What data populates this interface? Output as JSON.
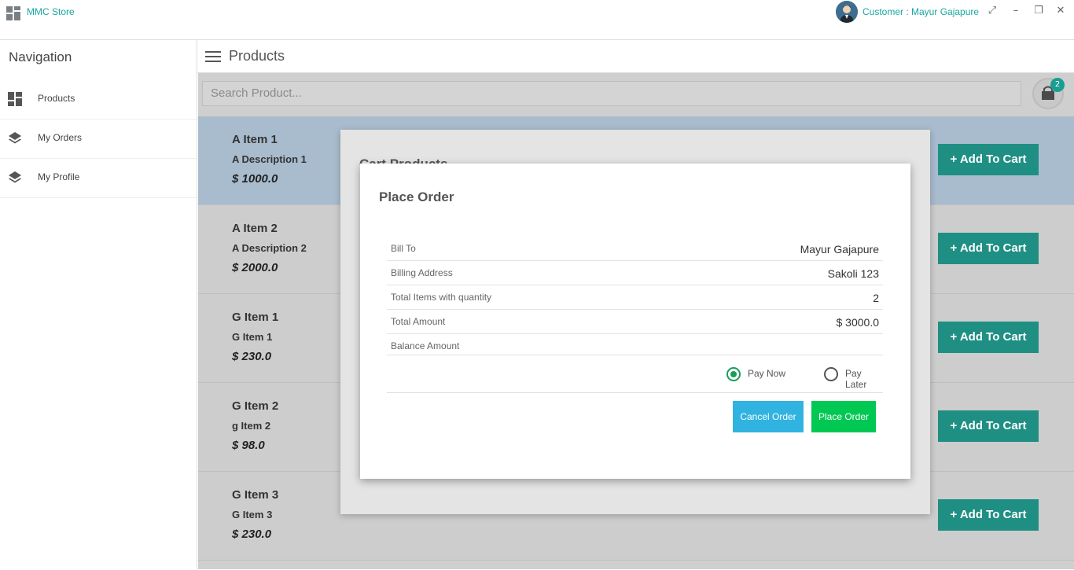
{
  "app": {
    "title": "MMC Store",
    "customer_label": "Customer : Mayur Gajapure"
  },
  "window_controls": [
    "expand-icon",
    "minimize-icon",
    "restore-icon",
    "close-icon"
  ],
  "sidebar": {
    "title": "Navigation",
    "items": [
      {
        "label": "Products",
        "icon": "dashboard-icon"
      },
      {
        "label": "My Orders",
        "icon": "layers-icon"
      },
      {
        "label": "My Profile",
        "icon": "layers-icon"
      }
    ]
  },
  "main": {
    "title": "Products",
    "search_placeholder": "Search Product...",
    "cart_count": "2"
  },
  "products": [
    {
      "name": "A Item 1",
      "description": "A Description 1",
      "price": "$ 1000.0",
      "button": "+ Add To Cart"
    },
    {
      "name": "A Item 2",
      "description": "A Description 2",
      "price": "$ 2000.0",
      "button": "+ Add To Cart"
    },
    {
      "name": "G Item 1",
      "description": "G Item 1",
      "price": "$ 230.0",
      "button": "+ Add To Cart"
    },
    {
      "name": "G Item 2",
      "description": "g Item 2",
      "price": "$ 98.0",
      "button": "+ Add To Cart"
    },
    {
      "name": "G Item 3",
      "description": "G Item 3",
      "price": "$ 230.0",
      "button": "+ Add To Cart"
    }
  ],
  "cart_dialog": {
    "title": "Cart Products"
  },
  "order_dialog": {
    "title": "Place Order",
    "rows": [
      {
        "label": "Bill To",
        "value": "Mayur Gajapure"
      },
      {
        "label": "Billing Address",
        "value": "Sakoli 123"
      },
      {
        "label": "Total Items with quantity",
        "value": "2"
      },
      {
        "label": "Total Amount",
        "value": "$ 3000.0"
      },
      {
        "label": "Balance Amount",
        "value": ""
      }
    ],
    "payment": {
      "options": [
        "Pay Now",
        "Pay Later"
      ],
      "selected": "Pay Now"
    },
    "cancel_label": "Cancel Order",
    "place_label": "Place Order"
  },
  "colors": {
    "accent": "#1aa7a0",
    "add_button": "#1f8f84",
    "cancel": "#30b3e0",
    "place": "#00c853",
    "selected_row": "#a9bccd"
  }
}
